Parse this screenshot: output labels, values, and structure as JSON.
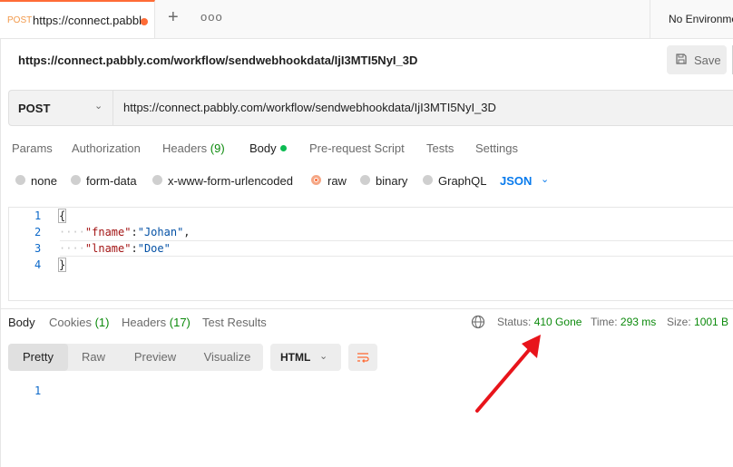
{
  "tab": {
    "method": "POST",
    "title": "https://connect.pabbl"
  },
  "environment": {
    "label": "No Environme"
  },
  "request": {
    "title": "https://connect.pabbly.com/workflow/sendwebhookdata/IjI3MTI5NyI_3D",
    "method": "POST",
    "url": "https://connect.pabbly.com/workflow/sendwebhookdata/IjI3MTI5NyI_3D"
  },
  "save": {
    "label": "Save"
  },
  "request_tabs": [
    {
      "label": "Params",
      "count": ""
    },
    {
      "label": "Authorization",
      "count": ""
    },
    {
      "label": "Headers",
      "count": "(9)"
    },
    {
      "label": "Body",
      "count": ""
    },
    {
      "label": "Pre-request Script",
      "count": ""
    },
    {
      "label": "Tests",
      "count": ""
    },
    {
      "label": "Settings",
      "count": ""
    }
  ],
  "body_types": [
    "none",
    "form-data",
    "x-www-form-urlencoded",
    "raw",
    "binary",
    "GraphQL"
  ],
  "body_format": "JSON",
  "editor": {
    "line_numbers": [
      "1",
      "2",
      "3",
      "4"
    ],
    "open_brace": "{",
    "close_brace": "}",
    "guide": "····",
    "fields": [
      {
        "key": "\"fname\"",
        "colon": ":",
        "value": "\"Johan\"",
        "comma": ","
      },
      {
        "key": "\"lname\"",
        "colon": ":",
        "value": "\"Doe\"",
        "comma": ""
      }
    ]
  },
  "response_tabs": [
    {
      "label": "Body",
      "count": ""
    },
    {
      "label": "Cookies",
      "count": "(1)"
    },
    {
      "label": "Headers",
      "count": "(17)"
    },
    {
      "label": "Test Results",
      "count": ""
    }
  ],
  "response_meta": {
    "status_label": "Status:",
    "status_value": "410 Gone",
    "time_label": "Time:",
    "time_value": "293 ms",
    "size_label": "Size:",
    "size_value": "1001 B"
  },
  "view_modes": [
    "Pretty",
    "Raw",
    "Preview",
    "Visualize"
  ],
  "response_format": "HTML",
  "response_line_numbers": [
    "1"
  ],
  "colors": {
    "accent": "#ff6c37",
    "success": "#0c8a0c",
    "link": "#097bed",
    "annotation_arrow": "#e8141b"
  }
}
